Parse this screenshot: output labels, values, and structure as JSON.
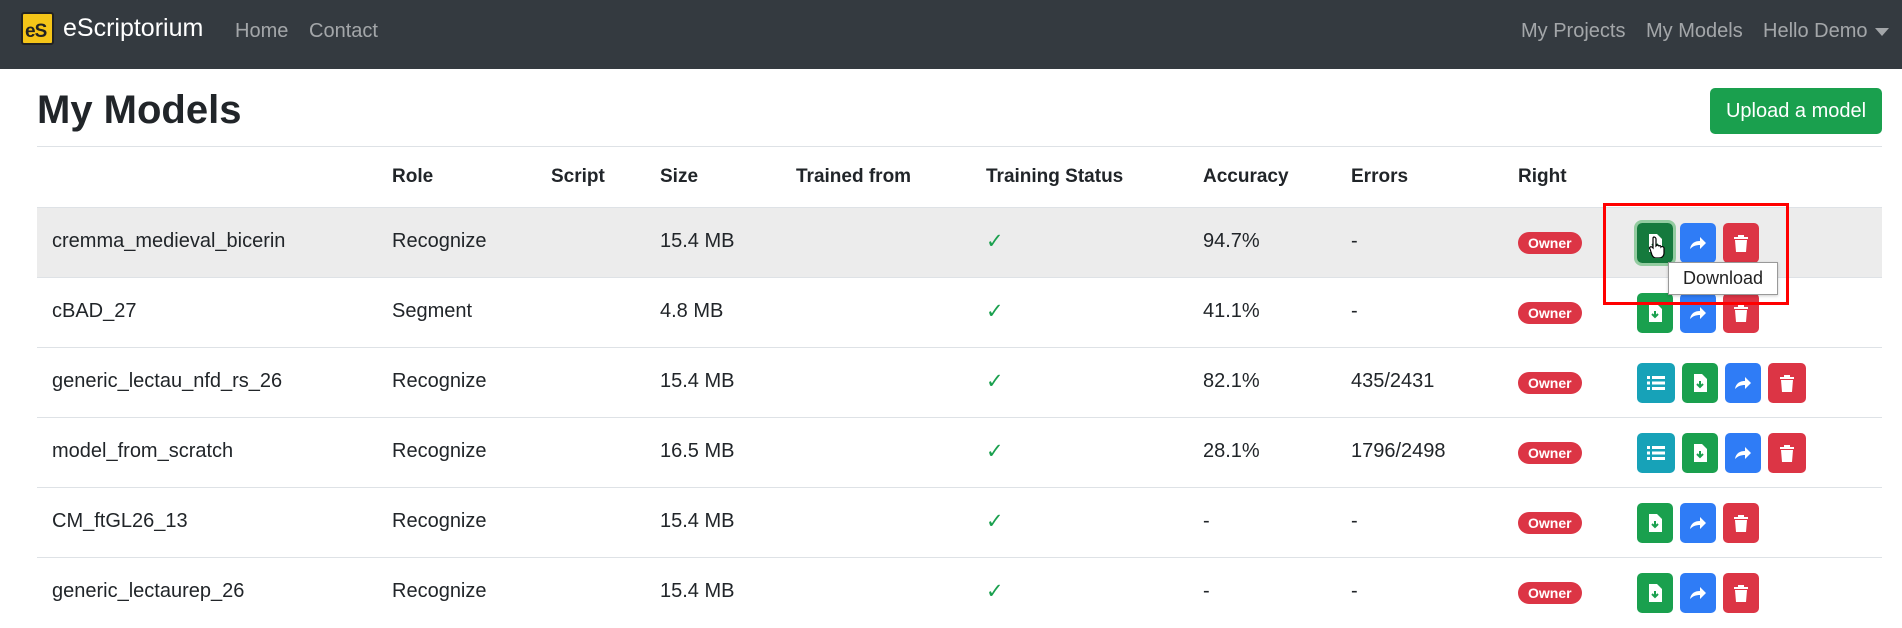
{
  "nav": {
    "brand": "eScriptorium",
    "logo_text": "eS",
    "home": "Home",
    "contact": "Contact",
    "my_projects": "My Projects",
    "my_models": "My Models",
    "user_menu": "Hello Demo"
  },
  "page": {
    "title": "My Models",
    "upload_button": "Upload a model"
  },
  "table": {
    "headers": [
      "Role",
      "Script",
      "Size",
      "Trained from",
      "Training Status",
      "Accuracy",
      "Errors",
      "Right"
    ],
    "rows": [
      {
        "name": "cremma_medieval_bicerin",
        "role": "Recognize",
        "script": "",
        "size": "15.4 MB",
        "trained_from": "",
        "status": "✓",
        "accuracy": "94.7%",
        "errors": "-",
        "right": "Owner"
      },
      {
        "name": "cBAD_27",
        "role": "Segment",
        "script": "",
        "size": "4.8 MB",
        "trained_from": "",
        "status": "✓",
        "accuracy": "41.1%",
        "errors": "-",
        "right": "Owner"
      },
      {
        "name": "generic_lectau_nfd_rs_26",
        "role": "Recognize",
        "script": "",
        "size": "15.4 MB",
        "trained_from": "",
        "status": "✓",
        "accuracy": "82.1%",
        "errors": "435/2431",
        "right": "Owner"
      },
      {
        "name": "model_from_scratch",
        "role": "Recognize",
        "script": "",
        "size": "16.5 MB",
        "trained_from": "",
        "status": "✓",
        "accuracy": "28.1%",
        "errors": "1796/2498",
        "right": "Owner"
      },
      {
        "name": "CM_ftGL26_13",
        "role": "Recognize",
        "script": "",
        "size": "15.4 MB",
        "trained_from": "",
        "status": "✓",
        "accuracy": "-",
        "errors": "-",
        "right": "Owner"
      },
      {
        "name": "generic_lectaurep_26",
        "role": "Recognize",
        "script": "",
        "size": "15.4 MB",
        "trained_from": "",
        "status": "✓",
        "accuracy": "-",
        "errors": "-",
        "right": "Owner"
      }
    ]
  },
  "tooltip": "Download",
  "icons": {
    "list": "list-icon",
    "download": "file-download-icon",
    "share": "share-icon",
    "delete": "trash-icon"
  },
  "colors": {
    "navbar": "#343a40",
    "success": "#1aa04e",
    "primary": "#2f7cf6",
    "danger": "#dc3545",
    "info": "#17a2b8",
    "highlight": "#ff0000"
  }
}
